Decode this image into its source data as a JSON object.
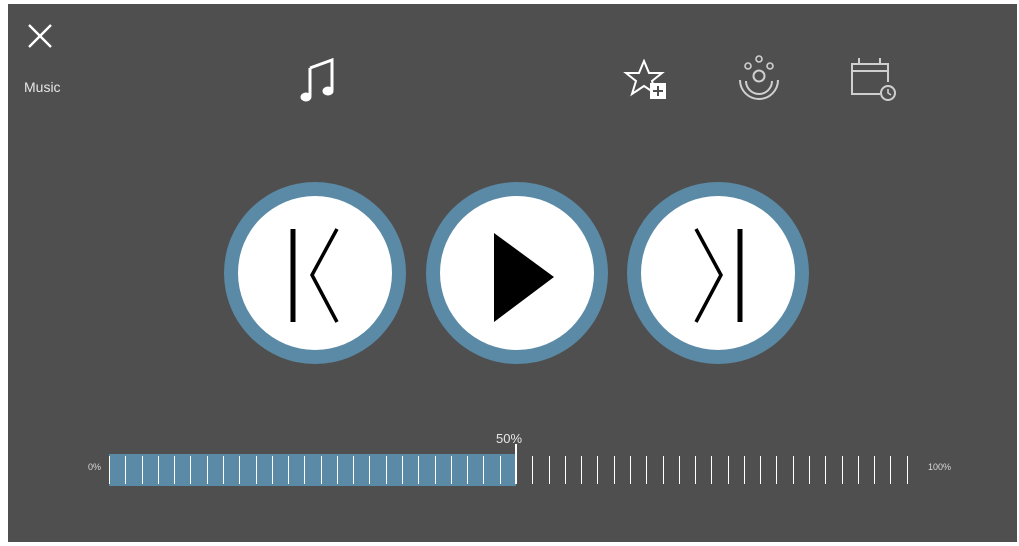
{
  "app": {
    "screen_label": "Music"
  },
  "toolbar": {
    "close_icon": "close-icon",
    "tabs": [
      {
        "icon": "music-note-icon",
        "active": true
      },
      {
        "icon": "star-add-icon",
        "active": false
      },
      {
        "icon": "listening-icon",
        "active": false
      },
      {
        "icon": "calendar-clock-icon",
        "active": false
      }
    ]
  },
  "controls": {
    "previous_icon": "previous-track-icon",
    "play_icon": "play-icon",
    "next_icon": "next-track-icon"
  },
  "progress": {
    "value_label": "50%",
    "min_label": "0%",
    "max_label": "100%",
    "value": 0.5,
    "segments": 50
  },
  "colors": {
    "background": "#4f4f4f",
    "accent": "#5b8aa6",
    "icon": "#ffffff"
  }
}
